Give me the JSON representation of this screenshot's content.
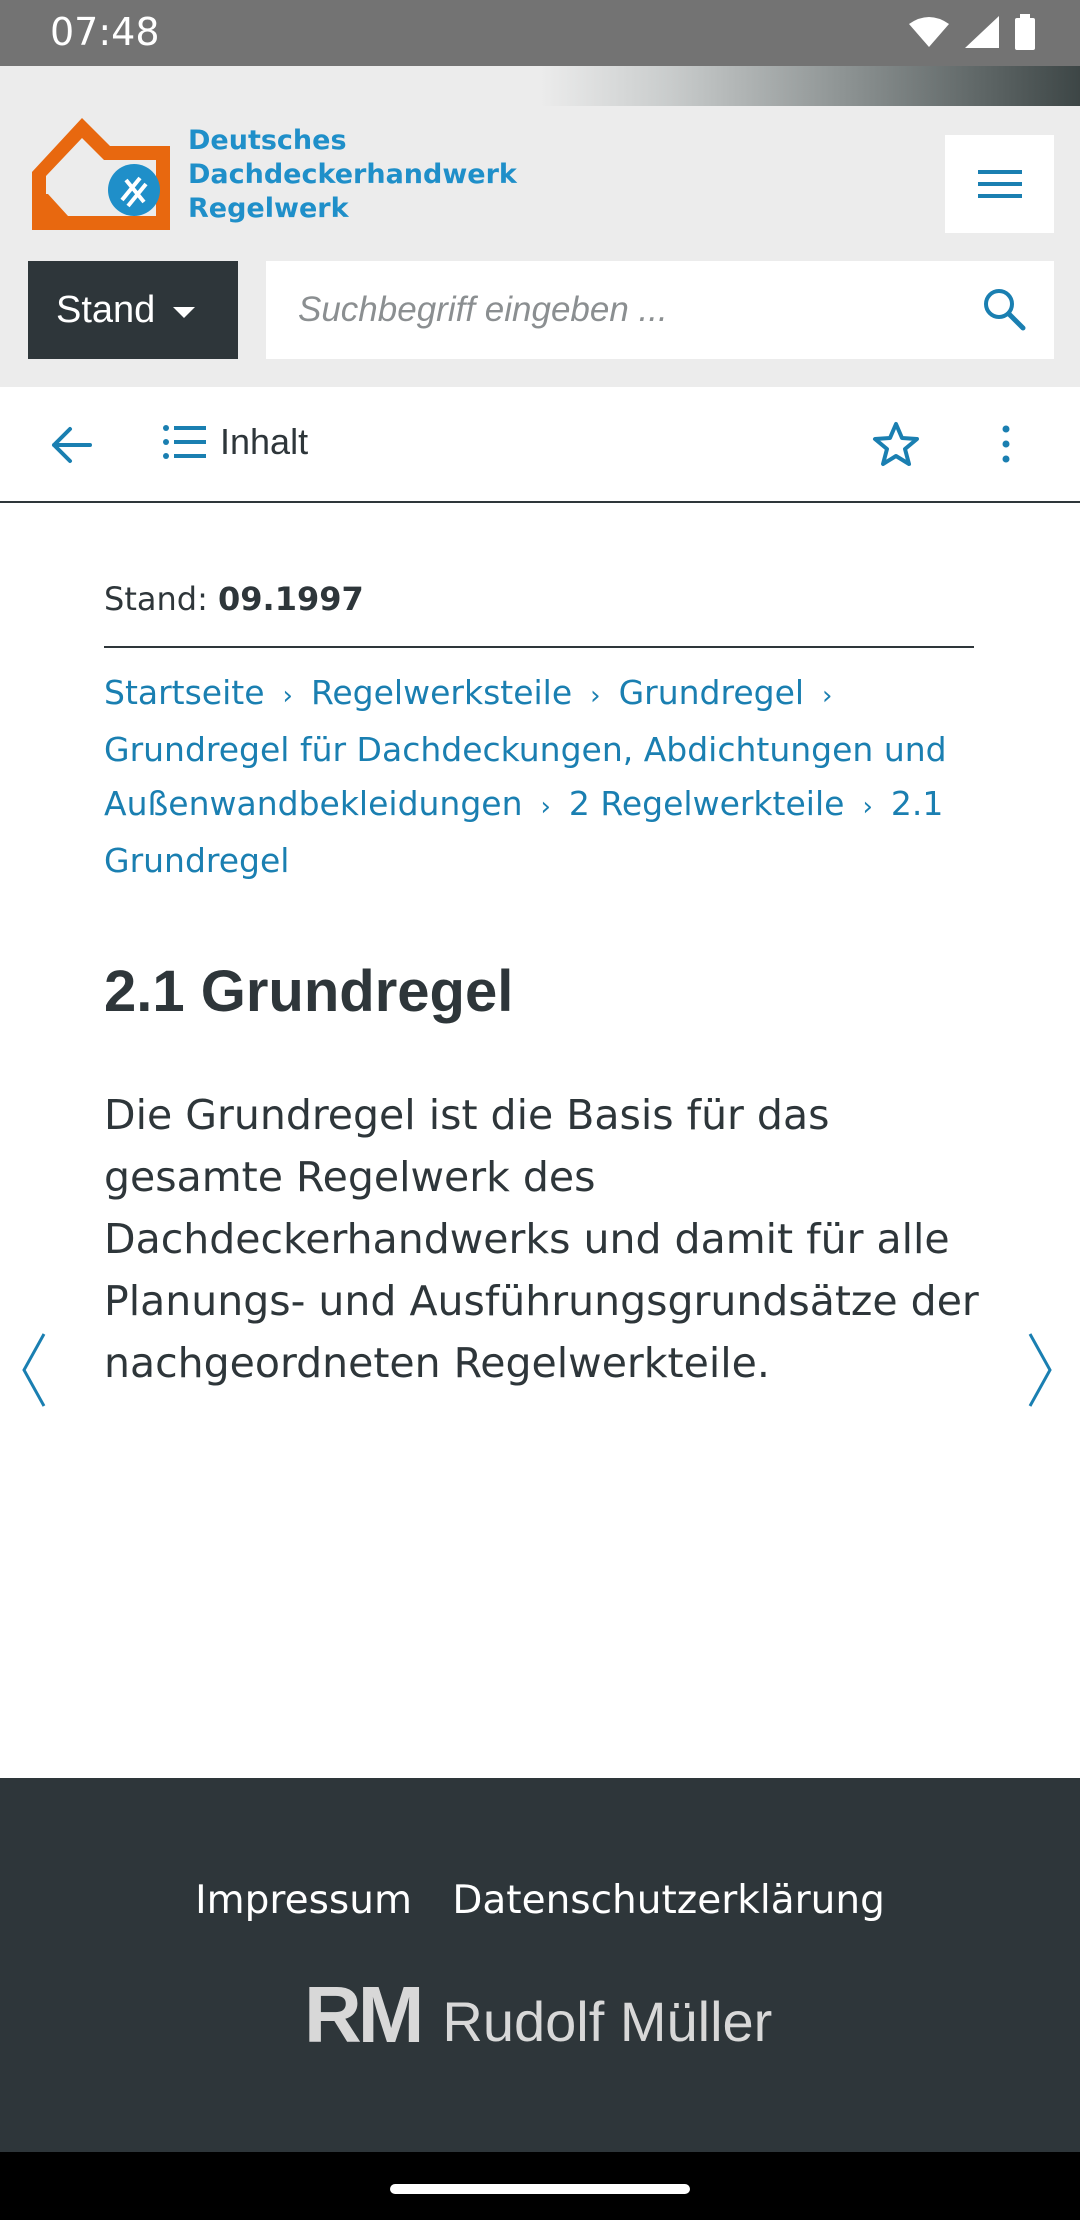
{
  "status_bar": {
    "time": "07:48"
  },
  "header": {
    "logo_lines": [
      "Deutsches",
      "Dachdeckerhandwerk",
      "Regelwerk"
    ],
    "stand_button": "Stand",
    "search_placeholder": "Suchbegriff eingeben ..."
  },
  "toolbar": {
    "contents_label": "Inhalt"
  },
  "content": {
    "stand_label": "Stand:",
    "stand_value": "09.1997",
    "breadcrumb": [
      "Startseite",
      "Regelwerksteile",
      "Grundregel",
      "Grundregel für Dachdeckungen, Abdichtungen und Außenwandbekleidungen",
      "2 Regelwerkteile",
      "2.1 Grundregel"
    ],
    "title": "2.1 Grundregel",
    "body": "Die Grundregel ist die Basis für das gesamte Regelwerk des Dachdeckerhandwerks und damit für alle Planungs- und Ausführungsgrundsätze der nachgeordneten Regelwerkteile."
  },
  "footer": {
    "impressum": "Impressum",
    "datenschutz": "Datenschutzerklärung",
    "brand_mark": "RM",
    "brand_name": "Rudolf Müller"
  },
  "colors": {
    "accent": "#1a7fb1",
    "logo_orange": "#e8680f",
    "dark": "#2e363a"
  },
  "icons": [
    "wifi-icon",
    "signal-icon",
    "battery-icon",
    "hamburger-menu-icon",
    "search-icon",
    "back-arrow-icon",
    "list-icon",
    "star-icon",
    "more-vert-icon",
    "chevron-left-icon",
    "chevron-right-icon",
    "breadcrumb-chevron-icon"
  ]
}
